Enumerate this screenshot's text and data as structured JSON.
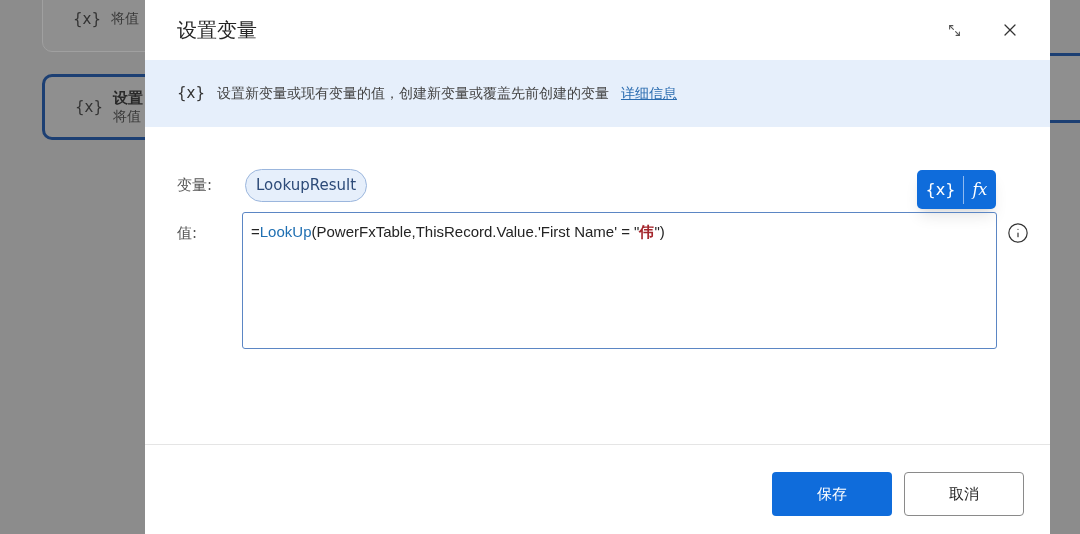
{
  "background_cards": [
    {
      "icon": "{x}",
      "subtitle": "将值",
      "selected": false
    },
    {
      "icon": "{x}",
      "title": "设置",
      "subtitle": "将值",
      "selected": true
    }
  ],
  "dialog": {
    "title": "设置变量",
    "banner": {
      "icon": "{x}",
      "text": "设置新变量或现有变量的值，创建新变量或覆盖先前创建的变量",
      "link": "详细信息"
    },
    "variable": {
      "label": "变量:",
      "value": "LookupResult"
    },
    "value": {
      "label": "值:",
      "segments": [
        {
          "kind": "plain",
          "text": "="
        },
        {
          "kind": "function",
          "text": "LookUp"
        },
        {
          "kind": "plain",
          "text": "(PowerFxTable,ThisRecord.Value.'First Name' = \""
        },
        {
          "kind": "string",
          "text": "伟"
        },
        {
          "kind": "plain",
          "text": "\")"
        }
      ]
    },
    "toolbar": [
      "{x}",
      "fx"
    ],
    "buttons": [
      {
        "label": "保存",
        "kind": "primary"
      },
      {
        "label": "取消",
        "kind": "secondary"
      }
    ]
  }
}
